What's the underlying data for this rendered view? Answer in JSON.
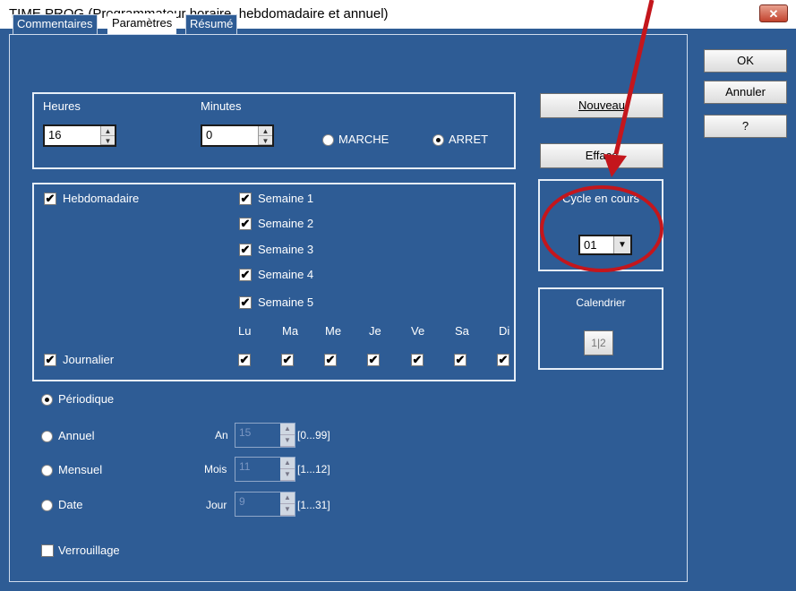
{
  "window": {
    "title": "TIME PROG (Programmateur horaire, hebdomadaire et annuel)",
    "close_label": "✕"
  },
  "tabs": [
    {
      "label": "Commentaires"
    },
    {
      "label": "Paramètres"
    },
    {
      "label": "Résumé"
    }
  ],
  "time": {
    "hours_label": "Heures",
    "hours_value": "16",
    "minutes_label": "Minutes",
    "minutes_value": "0",
    "marche_label": "MARCHE",
    "arret_label": "ARRET"
  },
  "weekly": {
    "hebdomadaire_label": "Hebdomadaire",
    "weeks": [
      {
        "label": "Semaine 1"
      },
      {
        "label": "Semaine 2"
      },
      {
        "label": "Semaine 3"
      },
      {
        "label": "Semaine 4"
      },
      {
        "label": "Semaine 5"
      }
    ],
    "days": [
      "Lu",
      "Ma",
      "Me",
      "Je",
      "Ve",
      "Sa",
      "Di"
    ],
    "journalier_label": "Journalier"
  },
  "mode": {
    "periodique_label": "Périodique",
    "annuel_label": "Annuel",
    "an_label": "An",
    "an_value": "15",
    "an_range": "[0...99]",
    "mensuel_label": "Mensuel",
    "mois_label": "Mois",
    "mois_value": "11",
    "mois_range": "[1...12]",
    "date_label": "Date",
    "jour_label": "Jour",
    "jour_value": "9",
    "jour_range": "[1...31]",
    "verrouillage_label": "Verrouillage"
  },
  "buttons": {
    "nouveau": "Nouveau",
    "efface": "Efface"
  },
  "cycle": {
    "label": "Cycle en cours",
    "value": "01"
  },
  "calendrier": {
    "label": "Calendrier",
    "icon_text": "1|2"
  },
  "side_buttons": {
    "ok": "OK",
    "annuler": "Annuler",
    "help": "?"
  }
}
